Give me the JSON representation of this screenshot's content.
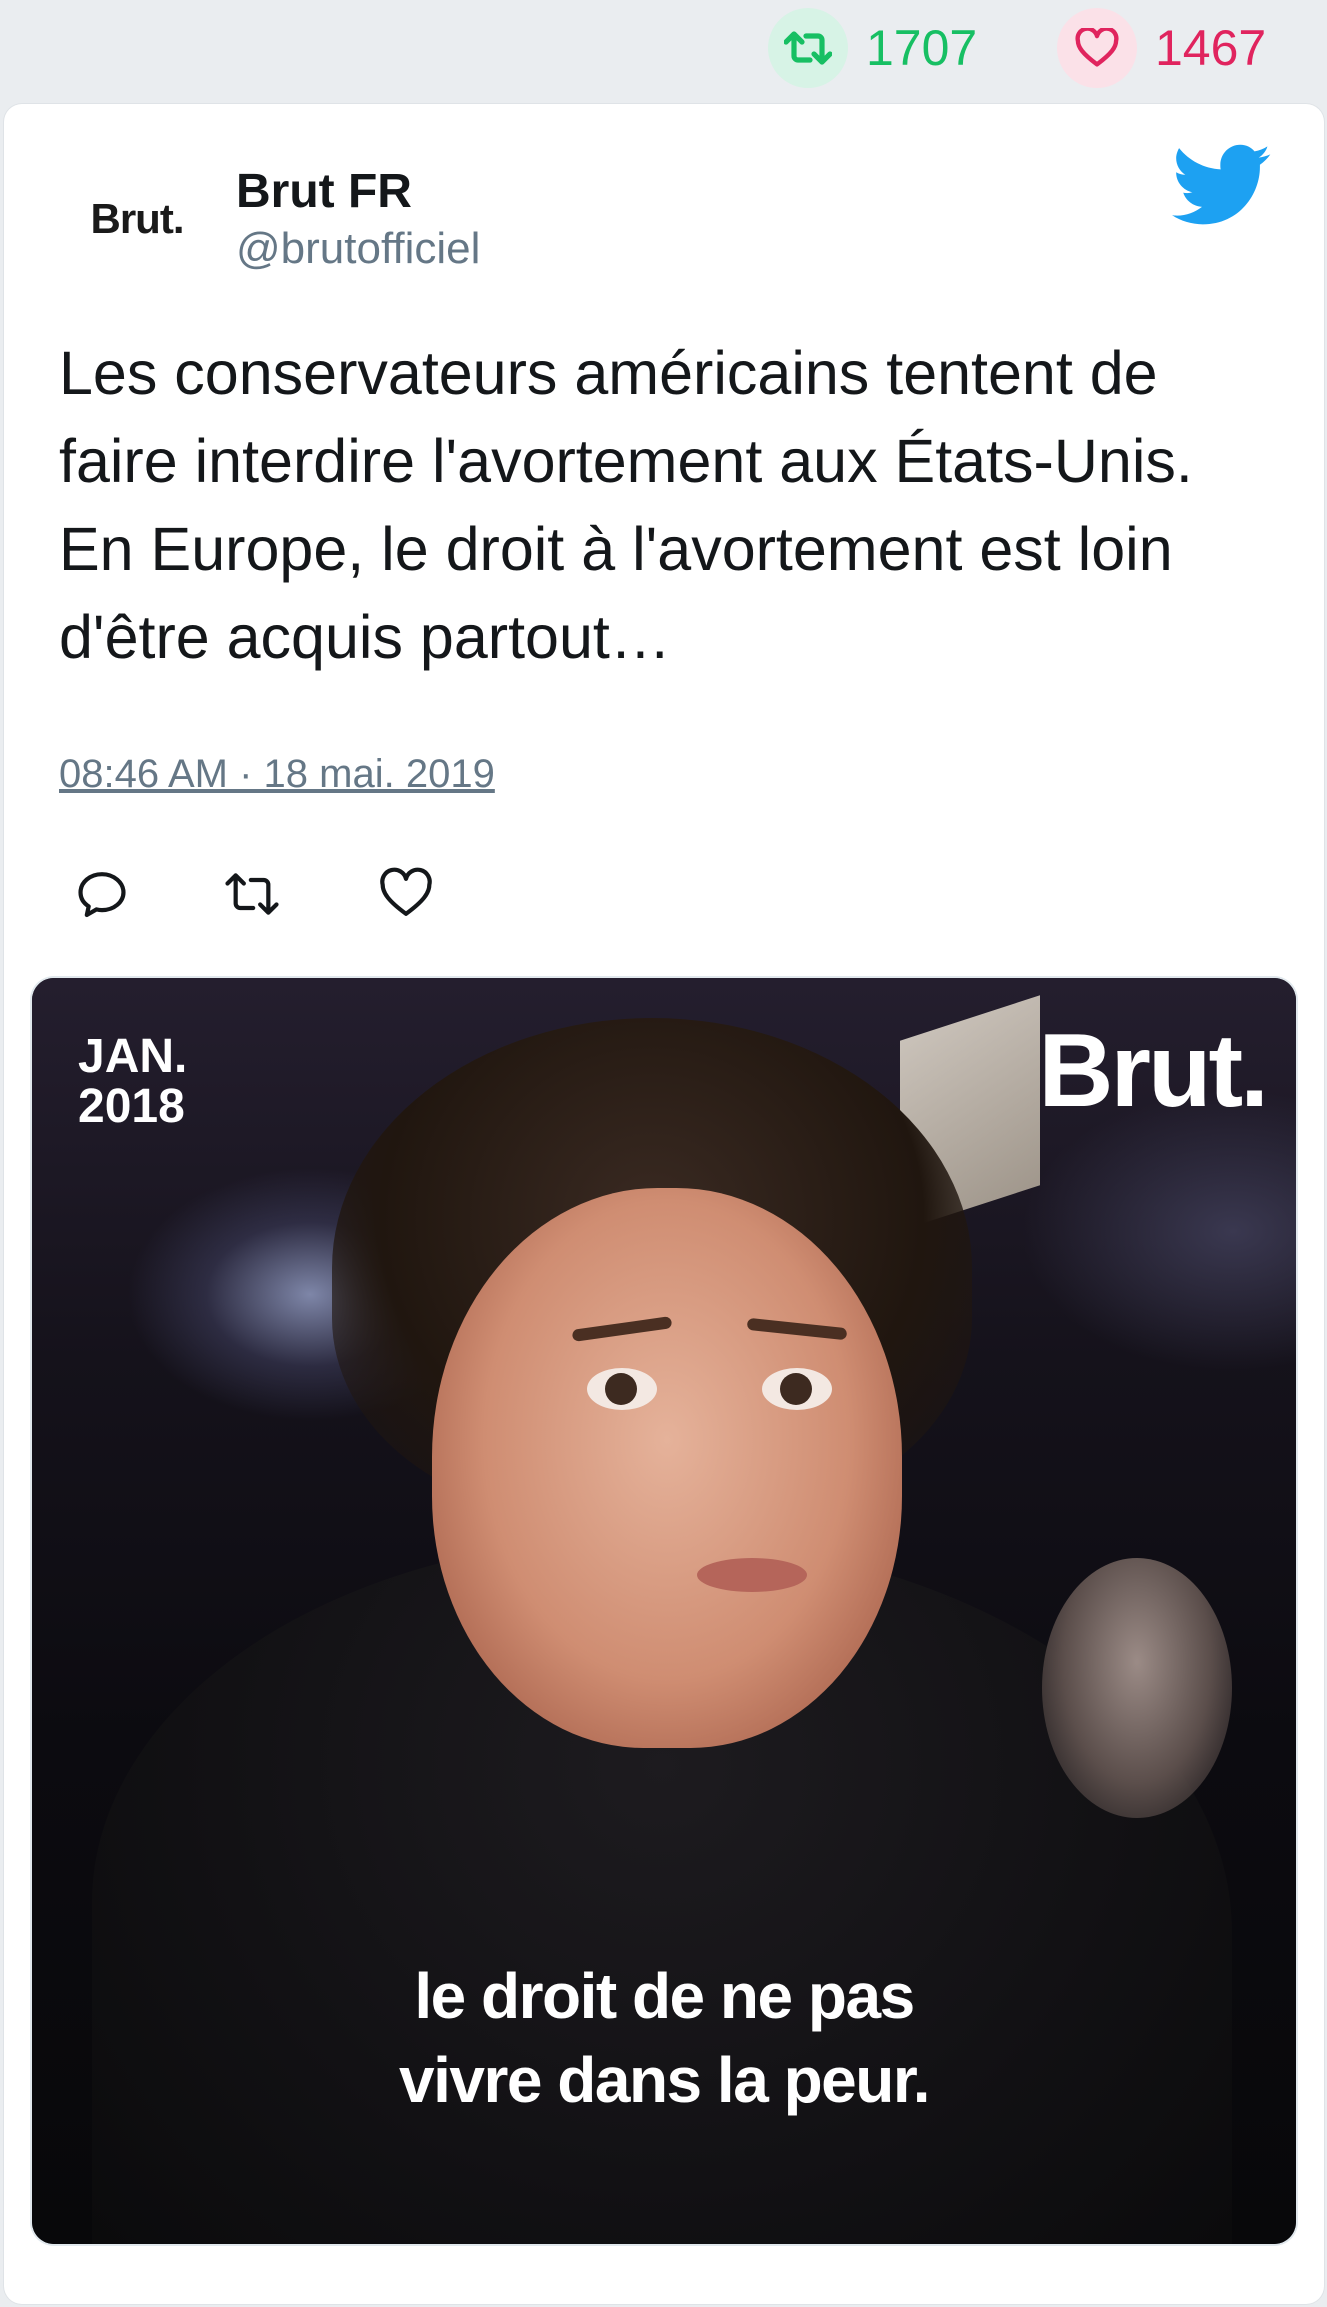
{
  "stats": {
    "retweet_count": "1707",
    "like_count": "1467",
    "retweet_icon": "retweet-icon",
    "like_icon": "heart-icon",
    "retweet_color": "#17bf63",
    "like_color": "#e0245e"
  },
  "tweet": {
    "avatar_logo": "Brut.",
    "display_name": "Brut FR",
    "handle": "@brutofficiel",
    "text": "Les conservateurs américains tentent de faire interdire l'avortement aux États-Unis. En Europe, le droit à l'avortement est loin d'être acquis partout…",
    "timestamp": "08:46 AM · 18 mai. 2019",
    "brand_icon": "twitter-bird-icon",
    "brand_color": "#1da1f2",
    "actions": [
      "reply-icon",
      "retweet-icon",
      "heart-icon"
    ]
  },
  "media": {
    "date_line1": "JAN.",
    "date_line2": "2018",
    "brand": "Brut.",
    "subtitle_line1": "le droit de ne pas",
    "subtitle_line2": "vivre dans la peur."
  }
}
